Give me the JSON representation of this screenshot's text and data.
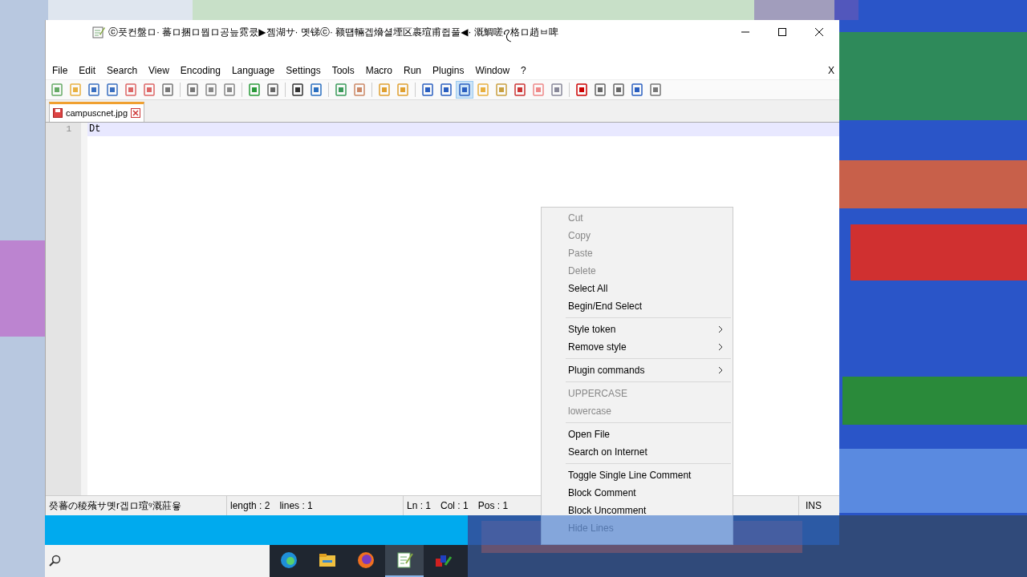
{
  "window": {
    "title": "ⓒ풋컨盤ロ· 蕃ロ捆ロ뭡ロ공늪霓쿴▶젬湖サ· 몟锑ⓒ· 额떕輛겝熁셜堙区裹瑄甫쥡풀◀· 溉鯛嗟ꪖ格ロ趙ㅂ啤"
  },
  "menu_bar": {
    "items": [
      "File",
      "Edit",
      "Search",
      "View",
      "Encoding",
      "Language",
      "Settings",
      "Tools",
      "Macro",
      "Run",
      "Plugins",
      "Window",
      "?"
    ],
    "close_char": "X"
  },
  "toolbar_buttons": [
    {
      "selected": false
    },
    {
      "selected": false
    },
    {
      "selected": false
    },
    {
      "selected": false
    },
    {
      "selected": false
    },
    {
      "selected": false
    },
    {
      "selected": false
    },
    {
      "selected": false
    },
    {
      "selected": false
    },
    {
      "selected": false
    },
    {
      "selected": false
    },
    {
      "selected": false
    },
    {
      "selected": false
    },
    {
      "selected": false
    },
    {
      "selected": false
    },
    {
      "selected": false
    },
    {
      "selected": false
    },
    {
      "selected": false
    },
    {
      "selected": false
    },
    {
      "selected": false
    },
    {
      "selected": true
    },
    {
      "selected": false
    },
    {
      "selected": false
    },
    {
      "selected": false
    },
    {
      "selected": false
    },
    {
      "selected": false
    },
    {
      "selected": false
    },
    {
      "selected": false
    },
    {
      "selected": false
    },
    {
      "selected": false
    },
    {
      "selected": false
    }
  ],
  "tabs": [
    {
      "label": "campuscnet.jpg",
      "selected": true
    }
  ],
  "editor": {
    "lines": [
      {
        "number": "1",
        "text": "Dt",
        "current": true
      }
    ]
  },
  "status_bar": {
    "message": "癸蕃の稜蕵サ몟r겝ロ瑄ꝰ溉莊윻",
    "length": "length : 2",
    "lines": "lines : 1",
    "ln": "Ln : 1",
    "col": "Col : 1",
    "pos": "Pos : 1",
    "mode": "INS"
  },
  "context_menu": {
    "items": [
      {
        "kind": "item",
        "label": "Cut",
        "disabled": true
      },
      {
        "kind": "item",
        "label": "Copy",
        "disabled": true
      },
      {
        "kind": "item",
        "label": "Paste",
        "disabled": true
      },
      {
        "kind": "item",
        "label": "Delete",
        "disabled": true
      },
      {
        "kind": "item",
        "label": "Select All",
        "disabled": false
      },
      {
        "kind": "item",
        "label": "Begin/End Select",
        "disabled": false
      },
      {
        "kind": "separator"
      },
      {
        "kind": "submenu",
        "label": "Style token",
        "disabled": false
      },
      {
        "kind": "submenu",
        "label": "Remove style",
        "disabled": false
      },
      {
        "kind": "separator"
      },
      {
        "kind": "submenu",
        "label": "Plugin commands",
        "disabled": false
      },
      {
        "kind": "separator"
      },
      {
        "kind": "item",
        "label": "UPPERCASE",
        "disabled": true
      },
      {
        "kind": "item",
        "label": "lowercase",
        "disabled": true
      },
      {
        "kind": "separator"
      },
      {
        "kind": "item",
        "label": "Open File",
        "disabled": false
      },
      {
        "kind": "item",
        "label": "Search on Internet",
        "disabled": false
      },
      {
        "kind": "separator"
      },
      {
        "kind": "item",
        "label": "Toggle Single Line Comment",
        "disabled": false
      },
      {
        "kind": "item",
        "label": "Block Comment",
        "disabled": false
      },
      {
        "kind": "item",
        "label": "Block Uncomment",
        "disabled": false
      },
      {
        "kind": "item",
        "label": "Hide Lines",
        "disabled": true
      }
    ]
  },
  "taskbar": {
    "apps": [
      {
        "selected": false
      },
      {
        "selected": false
      },
      {
        "selected": false
      },
      {
        "selected": true
      },
      {
        "selected": false
      }
    ]
  }
}
